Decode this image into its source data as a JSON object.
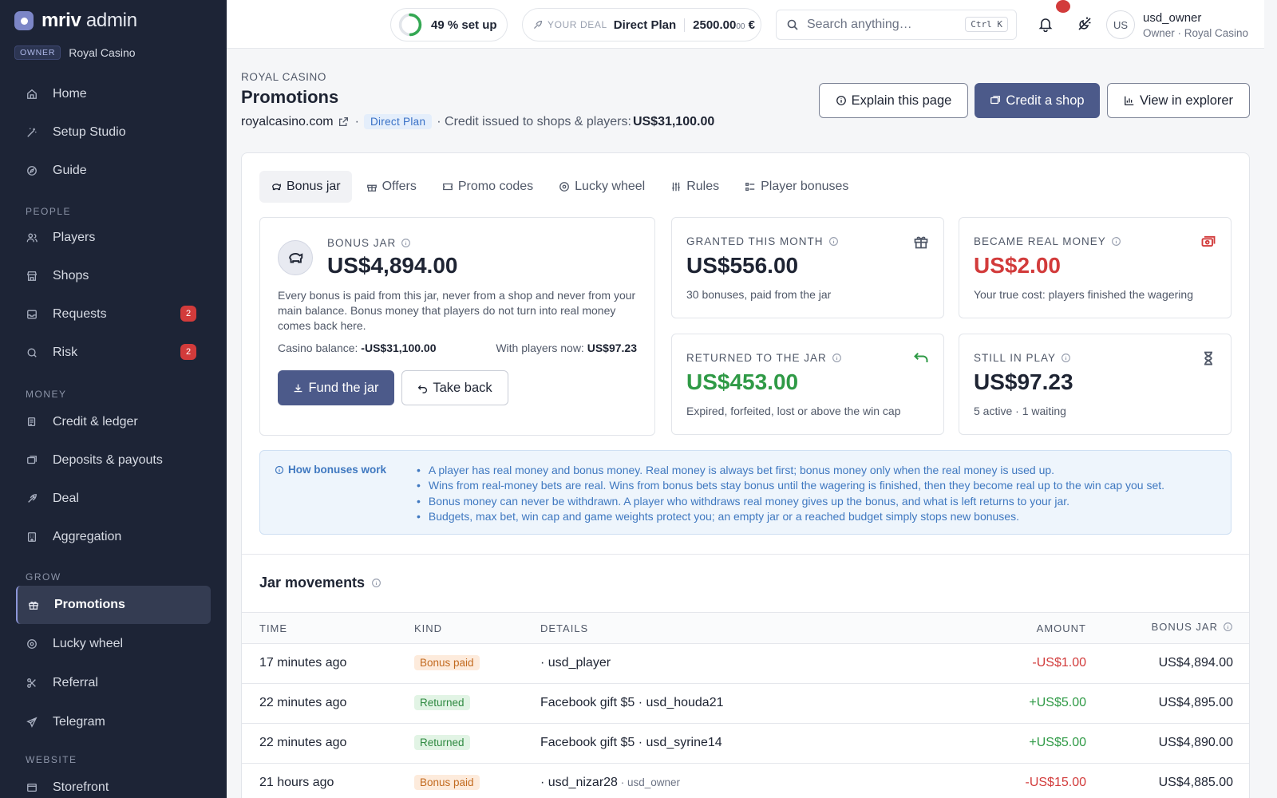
{
  "brand": {
    "name_bold": "mriv",
    "name_rest": " admin",
    "role_badge": "OWNER",
    "tenant": "Royal Casino"
  },
  "sidebar": {
    "top_items": [
      {
        "label": "Home",
        "icon": "home-icon"
      },
      {
        "label": "Setup Studio",
        "icon": "wand-icon"
      },
      {
        "label": "Guide",
        "icon": "compass-icon"
      }
    ],
    "sections": [
      {
        "title": "PEOPLE",
        "items": [
          {
            "label": "Players",
            "icon": "users-icon"
          },
          {
            "label": "Shops",
            "icon": "store-icon"
          },
          {
            "label": "Requests",
            "icon": "inbox-icon",
            "badge": "2"
          },
          {
            "label": "Risk",
            "icon": "radar-icon",
            "badge": "2"
          }
        ]
      },
      {
        "title": "MONEY",
        "items": [
          {
            "label": "Credit & ledger",
            "icon": "ledger-icon"
          },
          {
            "label": "Deposits & payouts",
            "icon": "transfer-icon"
          },
          {
            "label": "Deal",
            "icon": "rocket-icon"
          },
          {
            "label": "Aggregation",
            "icon": "building-icon"
          }
        ]
      },
      {
        "title": "GROW",
        "items": [
          {
            "label": "Promotions",
            "icon": "gift-icon",
            "active": true
          },
          {
            "label": "Lucky wheel",
            "icon": "wheel-icon"
          },
          {
            "label": "Referral",
            "icon": "share-icon"
          },
          {
            "label": "Telegram",
            "icon": "send-icon"
          }
        ]
      },
      {
        "title": "WEBSITE",
        "items": [
          {
            "label": "Storefront",
            "icon": "window-icon"
          }
        ]
      }
    ]
  },
  "topbar": {
    "progress_text": "49 % set up",
    "progress_value": 0.49,
    "deal_label": "YOUR DEAL",
    "deal_plan": "Direct Plan",
    "deal_value_main": "2500.00",
    "deal_value_small": "00",
    "deal_currency": " €",
    "search_placeholder": "Search anything…",
    "search_shortcut": "Ctrl K",
    "avatar_initials": "US",
    "user_name": "usd_owner",
    "user_role": "Owner · Royal Casino"
  },
  "header": {
    "eyebrow": "ROYAL CASINO",
    "title": "Promotions",
    "domain": "royalcasino.com",
    "plan_chip": "Direct Plan",
    "credit_text": "· Credit issued to shops & players: ",
    "credit_value": "US$31,100.00",
    "btn_explain": "Explain this page",
    "btn_credit": "Credit a shop",
    "btn_explorer": "View in explorer"
  },
  "tabs": [
    {
      "label": "Bonus jar",
      "icon": "piggy-icon",
      "active": true
    },
    {
      "label": "Offers",
      "icon": "gift-icon"
    },
    {
      "label": "Promo codes",
      "icon": "ticket-icon"
    },
    {
      "label": "Lucky wheel",
      "icon": "wheel-icon"
    },
    {
      "label": "Rules",
      "icon": "sliders-icon"
    },
    {
      "label": "Player bonuses",
      "icon": "list-icon"
    }
  ],
  "jar": {
    "label": "BONUS JAR",
    "value": "US$4,894.00",
    "description": "Every bonus is paid from this jar, never from a shop and never from your main balance. Bonus money that players do not turn into real money comes back here.",
    "casino_balance_label": "Casino balance: ",
    "casino_balance_value": "-US$31,100.00",
    "players_label": "With players now: ",
    "players_value": "US$97.23",
    "btn_fund": "Fund the jar",
    "btn_take": "Take back"
  },
  "stats": {
    "granted": {
      "label": "GRANTED THIS MONTH",
      "value": "US$556.00",
      "sub": "30 bonuses, paid from the jar",
      "icon": "gift-icon"
    },
    "real": {
      "label": "BECAME REAL MONEY",
      "value": "US$2.00",
      "sub": "Your true cost: players finished the wagering",
      "icon": "cash-icon",
      "color": "#d23b3b"
    },
    "returned": {
      "label": "RETURNED TO THE JAR",
      "value": "US$453.00",
      "sub": "Expired, forfeited, lost or above the win cap",
      "icon": "return-icon",
      "color": "#2f9a46"
    },
    "inplay": {
      "label": "STILL IN PLAY",
      "value": "US$97.23",
      "sub": "5 active · 1 waiting",
      "icon": "hourglass-icon"
    }
  },
  "howto": {
    "title": "How bonuses work",
    "items": [
      "A player has real money and bonus money. Real money is always bet first; bonus money only when the real money is used up.",
      "Wins from real-money bets are real. Wins from bonus bets stay bonus until the wagering is finished, then they become real up to the win cap you set.",
      "Bonus money can never be withdrawn. A player who withdraws real money gives up the bonus, and what is left returns to your jar.",
      "Budgets, max bet, win cap and game weights protect you; an empty jar or a reached budget simply stops new bonuses."
    ]
  },
  "movements": {
    "title": "Jar movements",
    "columns": {
      "time": "TIME",
      "kind": "KIND",
      "details": "DETAILS",
      "amount": "AMOUNT",
      "jar": "BONUS JAR"
    },
    "rows": [
      {
        "time": "17 minutes ago",
        "kind": "Bonus paid",
        "kind_type": "paid",
        "details": "· usd_player",
        "details_extra": "",
        "amount": "-US$1.00",
        "jar": "US$4,894.00"
      },
      {
        "time": "22 minutes ago",
        "kind": "Returned",
        "kind_type": "ret",
        "details": "Facebook gift $5 · usd_houda21",
        "details_extra": "",
        "amount": "+US$5.00",
        "jar": "US$4,895.00"
      },
      {
        "time": "22 minutes ago",
        "kind": "Returned",
        "kind_type": "ret",
        "details": "Facebook gift $5 · usd_syrine14",
        "details_extra": "",
        "amount": "+US$5.00",
        "jar": "US$4,890.00"
      },
      {
        "time": "21 hours ago",
        "kind": "Bonus paid",
        "kind_type": "paid",
        "details": "· usd_nizar28",
        "details_extra": " · usd_owner",
        "amount": "-US$15.00",
        "jar": "US$4,885.00"
      }
    ]
  }
}
